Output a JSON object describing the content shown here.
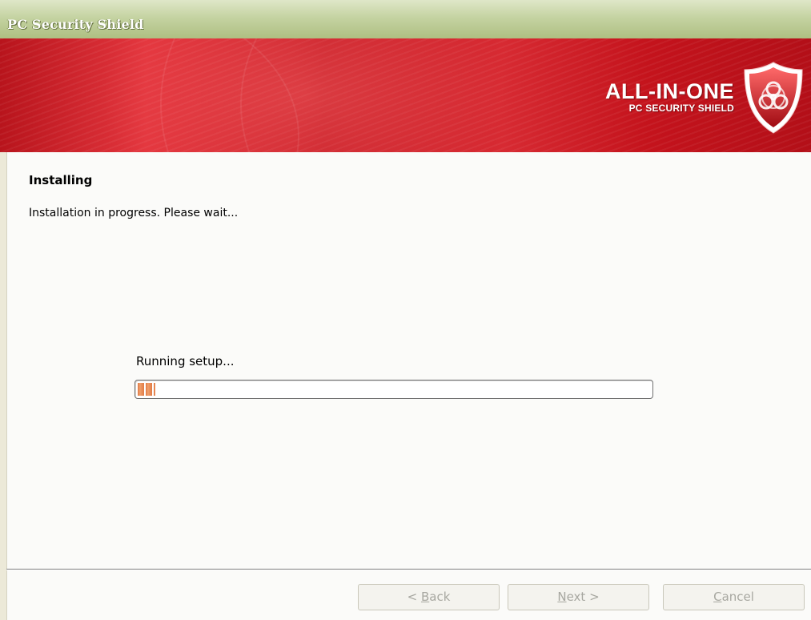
{
  "window": {
    "title": "PC Security Shield"
  },
  "banner": {
    "brand_main": "ALL-IN-ONE",
    "brand_sub": "PC SECURITY SHIELD",
    "shield_icon": "biohazard-shield-icon"
  },
  "content": {
    "heading": "Installing",
    "subheading": "Installation in progress. Please wait...",
    "status": "Running setup...",
    "progress_fraction": 0.035
  },
  "buttons": {
    "back": {
      "prefix": "< ",
      "mnemonic": "B",
      "rest": "ack"
    },
    "next": {
      "mnemonic": "N",
      "rest": "ext >"
    },
    "cancel": {
      "mnemonic": "C",
      "rest": "ancel"
    }
  },
  "colors": {
    "banner_red": "#c81d26",
    "titlebar_green": "#c5d3a2",
    "progress_orange": "#e07a45"
  }
}
